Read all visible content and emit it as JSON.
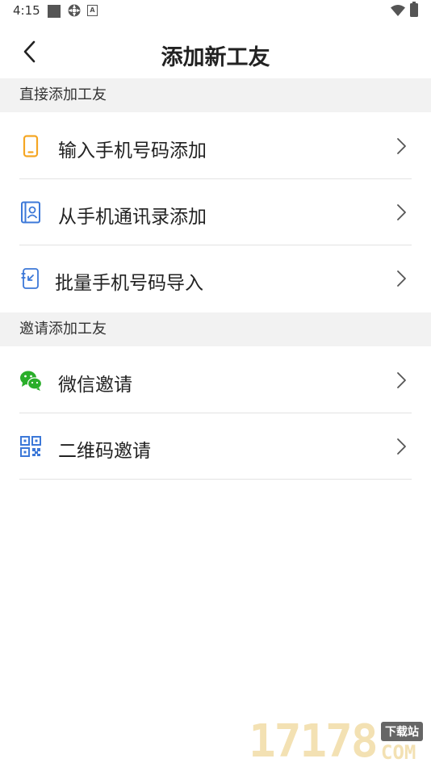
{
  "status_bar": {
    "time": "4:15",
    "notification_letter": "A"
  },
  "header": {
    "title": "添加新工友"
  },
  "sections": [
    {
      "title": "直接添加工友",
      "items": [
        {
          "label": "输入手机号码添加",
          "icon": "phone-icon"
        },
        {
          "label": "从手机通讯录添加",
          "icon": "contacts-icon"
        },
        {
          "label": "批量手机号码导入",
          "icon": "import-icon"
        }
      ]
    },
    {
      "title": "邀请添加工友",
      "items": [
        {
          "label": "微信邀请",
          "icon": "wechat-icon"
        },
        {
          "label": "二维码邀请",
          "icon": "qrcode-icon"
        }
      ]
    }
  ],
  "colors": {
    "phone_icon": "#f5a623",
    "blue_icon": "#3c78d8",
    "wechat_icon": "#2aae2a",
    "section_bg": "#f2f2f2",
    "divider": "#e3e3e3"
  },
  "watermark": {
    "number": "17178",
    "tag": "下载站",
    "domain": "COM"
  }
}
